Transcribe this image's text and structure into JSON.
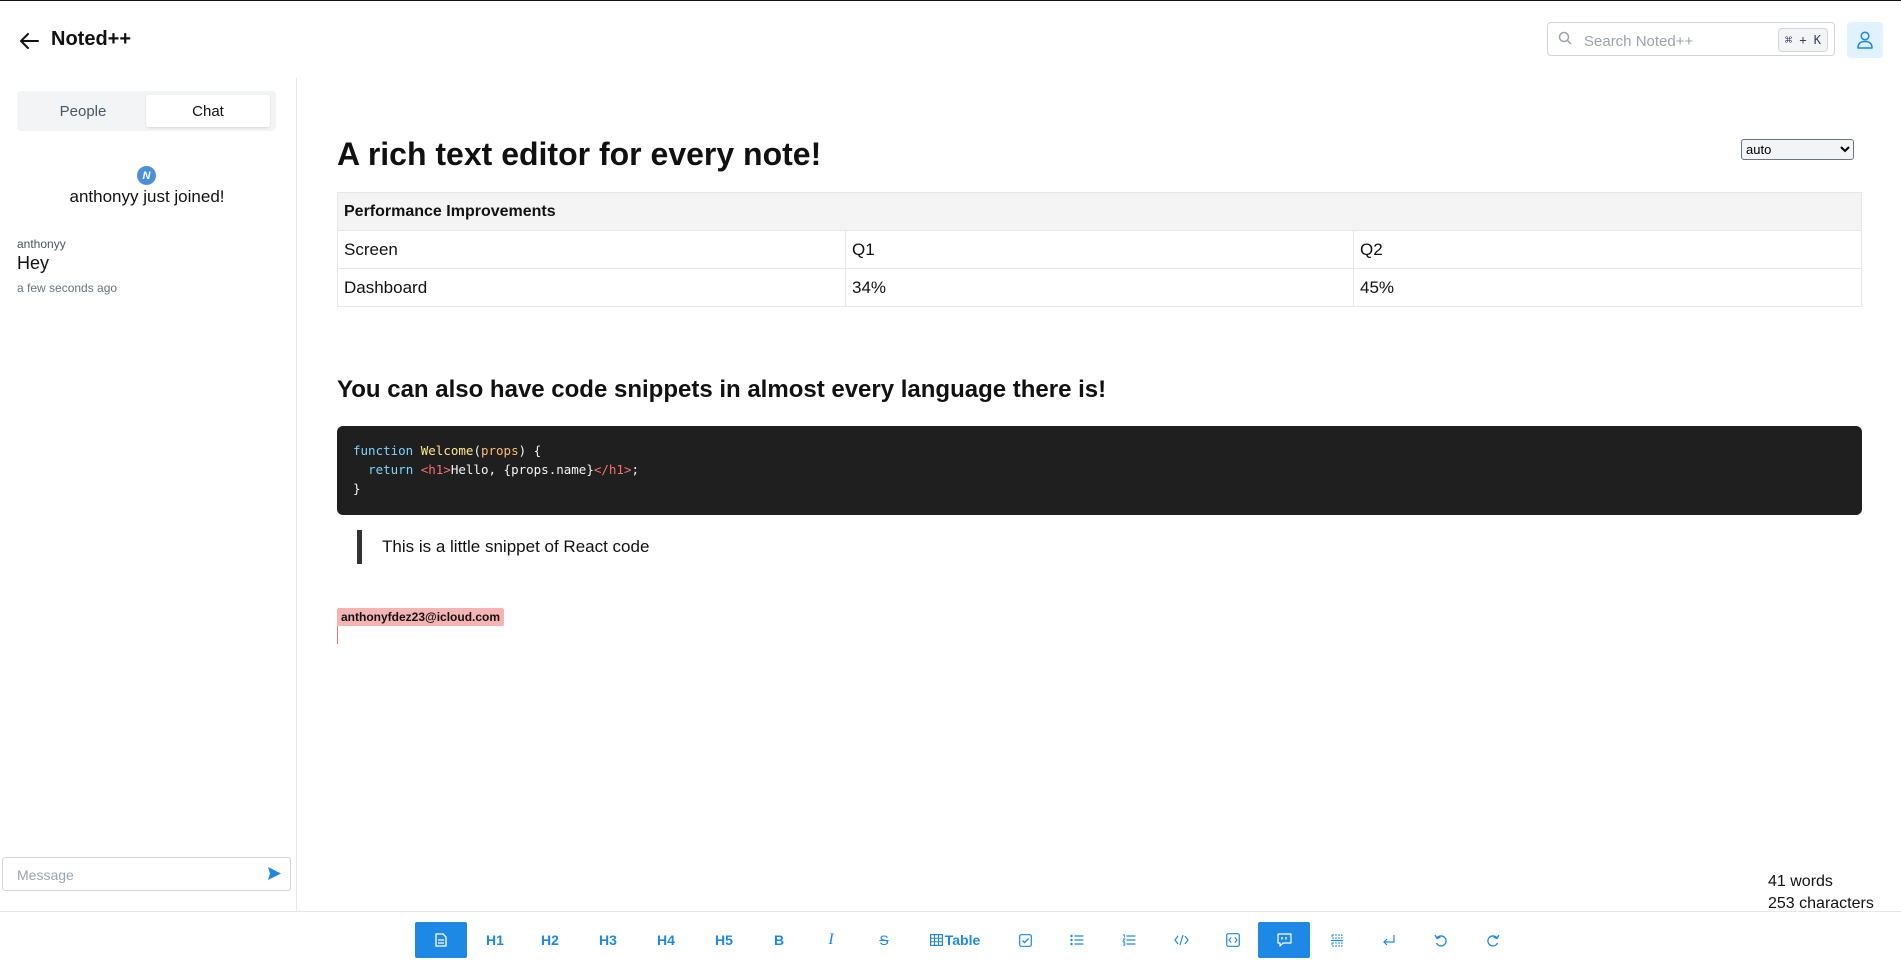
{
  "header": {
    "title": "Noted++",
    "search_placeholder": "Search Noted++",
    "shortcut": "⌘ + K"
  },
  "sidebar": {
    "tabs": [
      {
        "label": "People",
        "active": false
      },
      {
        "label": "Chat",
        "active": true
      }
    ],
    "join_avatar_letter": "N",
    "join_message": "anthonyy just joined!",
    "message": {
      "author": "anthonyy",
      "text": "Hey",
      "time": "a few seconds ago"
    },
    "message_placeholder": "Message"
  },
  "editor": {
    "language_select": {
      "value": "auto",
      "options": [
        "auto"
      ]
    },
    "title": "A rich text editor for every note!",
    "table": {
      "header": "Performance Improvements",
      "rows": [
        [
          "Screen",
          "Q1",
          "Q2"
        ],
        [
          "Dashboard",
          "34%",
          "45%"
        ]
      ]
    },
    "subheading": "You can also have code snippets in almost every language there is!",
    "code": {
      "line1_kw": "function",
      "line1_fn": "Welcome",
      "line1_param": "props",
      "line2_kw": "return",
      "line2_open_tag": "<h1>",
      "line2_text": "Hello, {props.name}",
      "line2_close_tag": "</h1>",
      "line3": "}"
    },
    "quote": "This is a little snippet of React code",
    "cursor_user": "anthonyfdez23@icloud.com"
  },
  "stats": {
    "words": "41 words",
    "characters": "253 characters"
  },
  "toolbar": {
    "h1": "H1",
    "h2": "H2",
    "h3": "H3",
    "h4": "H4",
    "h5": "H5",
    "bold": "B",
    "italic": "I",
    "strike": "S",
    "table": "Table"
  },
  "colors": {
    "accent": "#1e88e5",
    "code_bg": "#1f1f1f",
    "cursor_label_bg": "#f4b4b4"
  }
}
